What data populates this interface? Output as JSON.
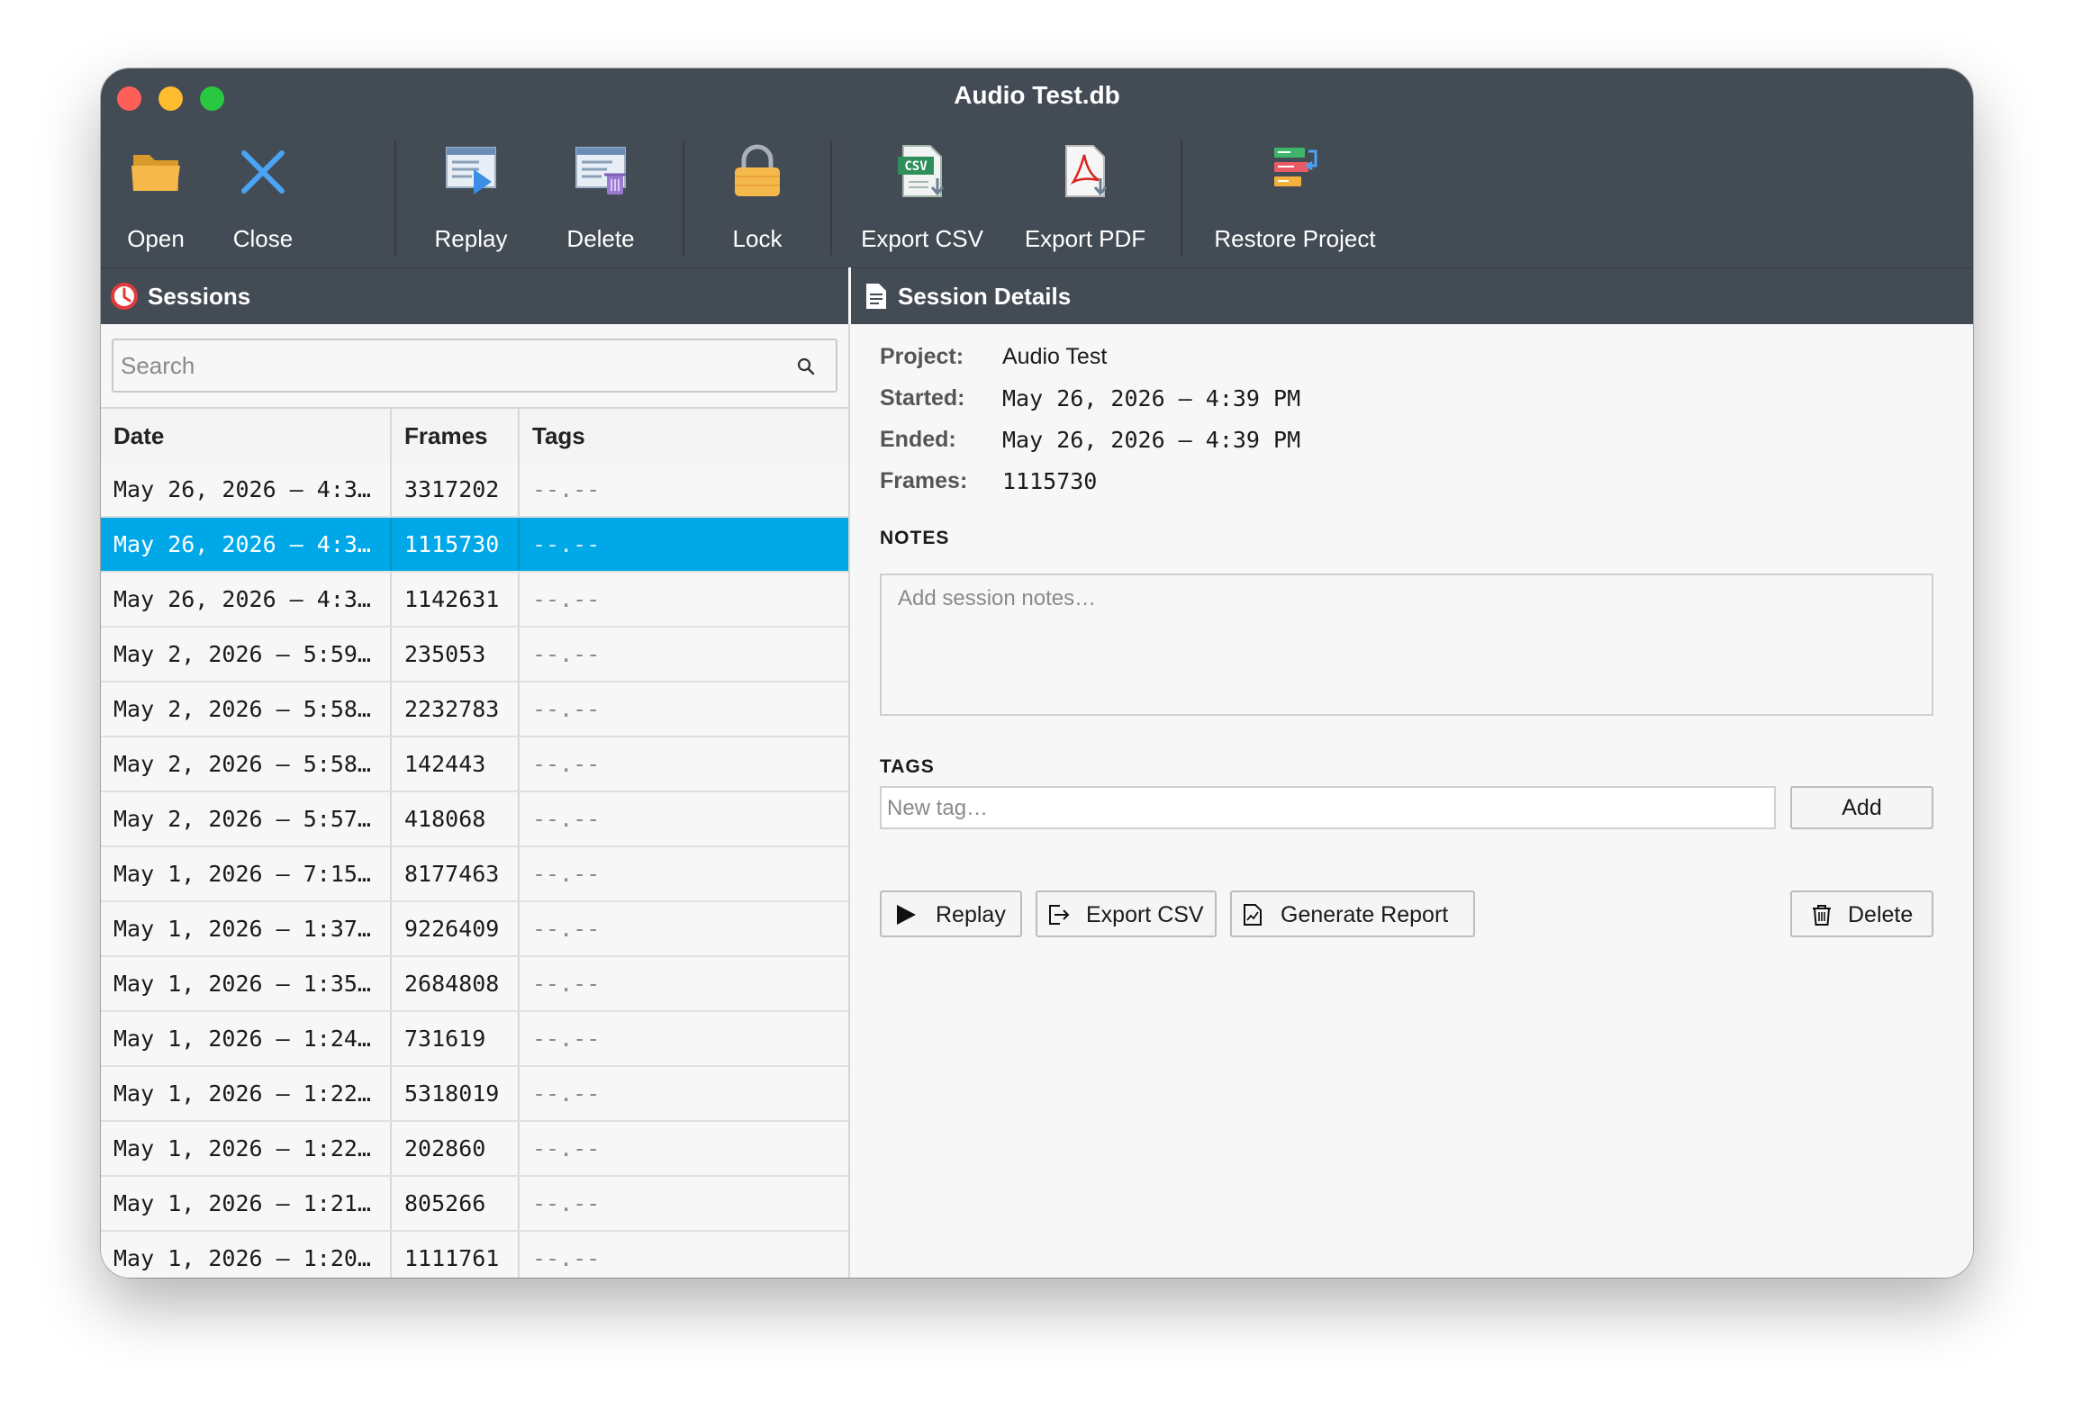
{
  "window": {
    "title": "Audio Test.db"
  },
  "toolbar": {
    "open": "Open",
    "close": "Close",
    "replay": "Replay",
    "delete": "Delete",
    "lock": "Lock",
    "export_csv": "Export CSV",
    "export_csv_badge": "CSV",
    "export_pdf": "Export PDF",
    "restore_project": "Restore Project"
  },
  "sessions": {
    "title": "Sessions",
    "search_placeholder": "Search",
    "columns": {
      "date": "Date",
      "frames": "Frames",
      "tags": "Tags"
    },
    "selected_index": 1,
    "rows": [
      {
        "date": "May 26, 2026 – 4:3…",
        "frames": "3317202",
        "tags": "--.--"
      },
      {
        "date": "May 26, 2026 – 4:3…",
        "frames": "1115730",
        "tags": "--.--"
      },
      {
        "date": "May 26, 2026 – 4:3…",
        "frames": "1142631",
        "tags": "--.--"
      },
      {
        "date": "May 2, 2026 – 5:59…",
        "frames": "235053",
        "tags": "--.--"
      },
      {
        "date": "May 2, 2026 – 5:58…",
        "frames": "2232783",
        "tags": "--.--"
      },
      {
        "date": "May 2, 2026 – 5:58…",
        "frames": "142443",
        "tags": "--.--"
      },
      {
        "date": "May 2, 2026 – 5:57…",
        "frames": "418068",
        "tags": "--.--"
      },
      {
        "date": "May 1, 2026 – 7:15…",
        "frames": "8177463",
        "tags": "--.--"
      },
      {
        "date": "May 1, 2026 – 1:37…",
        "frames": "9226409",
        "tags": "--.--"
      },
      {
        "date": "May 1, 2026 – 1:35…",
        "frames": "2684808",
        "tags": "--.--"
      },
      {
        "date": "May 1, 2026 – 1:24…",
        "frames": "731619",
        "tags": "--.--"
      },
      {
        "date": "May 1, 2026 – 1:22…",
        "frames": "5318019",
        "tags": "--.--"
      },
      {
        "date": "May 1, 2026 – 1:22…",
        "frames": "202860",
        "tags": "--.--"
      },
      {
        "date": "May 1, 2026 – 1:21…",
        "frames": "805266",
        "tags": "--.--"
      },
      {
        "date": "May 1, 2026 – 1:20…",
        "frames": "1111761",
        "tags": "--.--"
      }
    ]
  },
  "details": {
    "title": "Session Details",
    "project_label": "Project:",
    "project_value": "Audio Test",
    "started_label": "Started:",
    "started_value": "May 26, 2026 – 4:39 PM",
    "ended_label": "Ended:",
    "ended_value": "May 26, 2026 – 4:39 PM",
    "frames_label": "Frames:",
    "frames_value": "1115730",
    "notes_label": "NOTES",
    "notes_placeholder": "Add session notes…",
    "tags_label": "TAGS",
    "tag_placeholder": "New tag…",
    "add_button": "Add",
    "replay_button": "Replay",
    "export_csv_button": "Export CSV",
    "generate_report_button": "Generate Report",
    "delete_button": "Delete"
  },
  "colors": {
    "titlebar": "#434b54",
    "selection": "#00a8e8",
    "folder": "#f5b84a",
    "close_x": "#4aa3f5"
  }
}
